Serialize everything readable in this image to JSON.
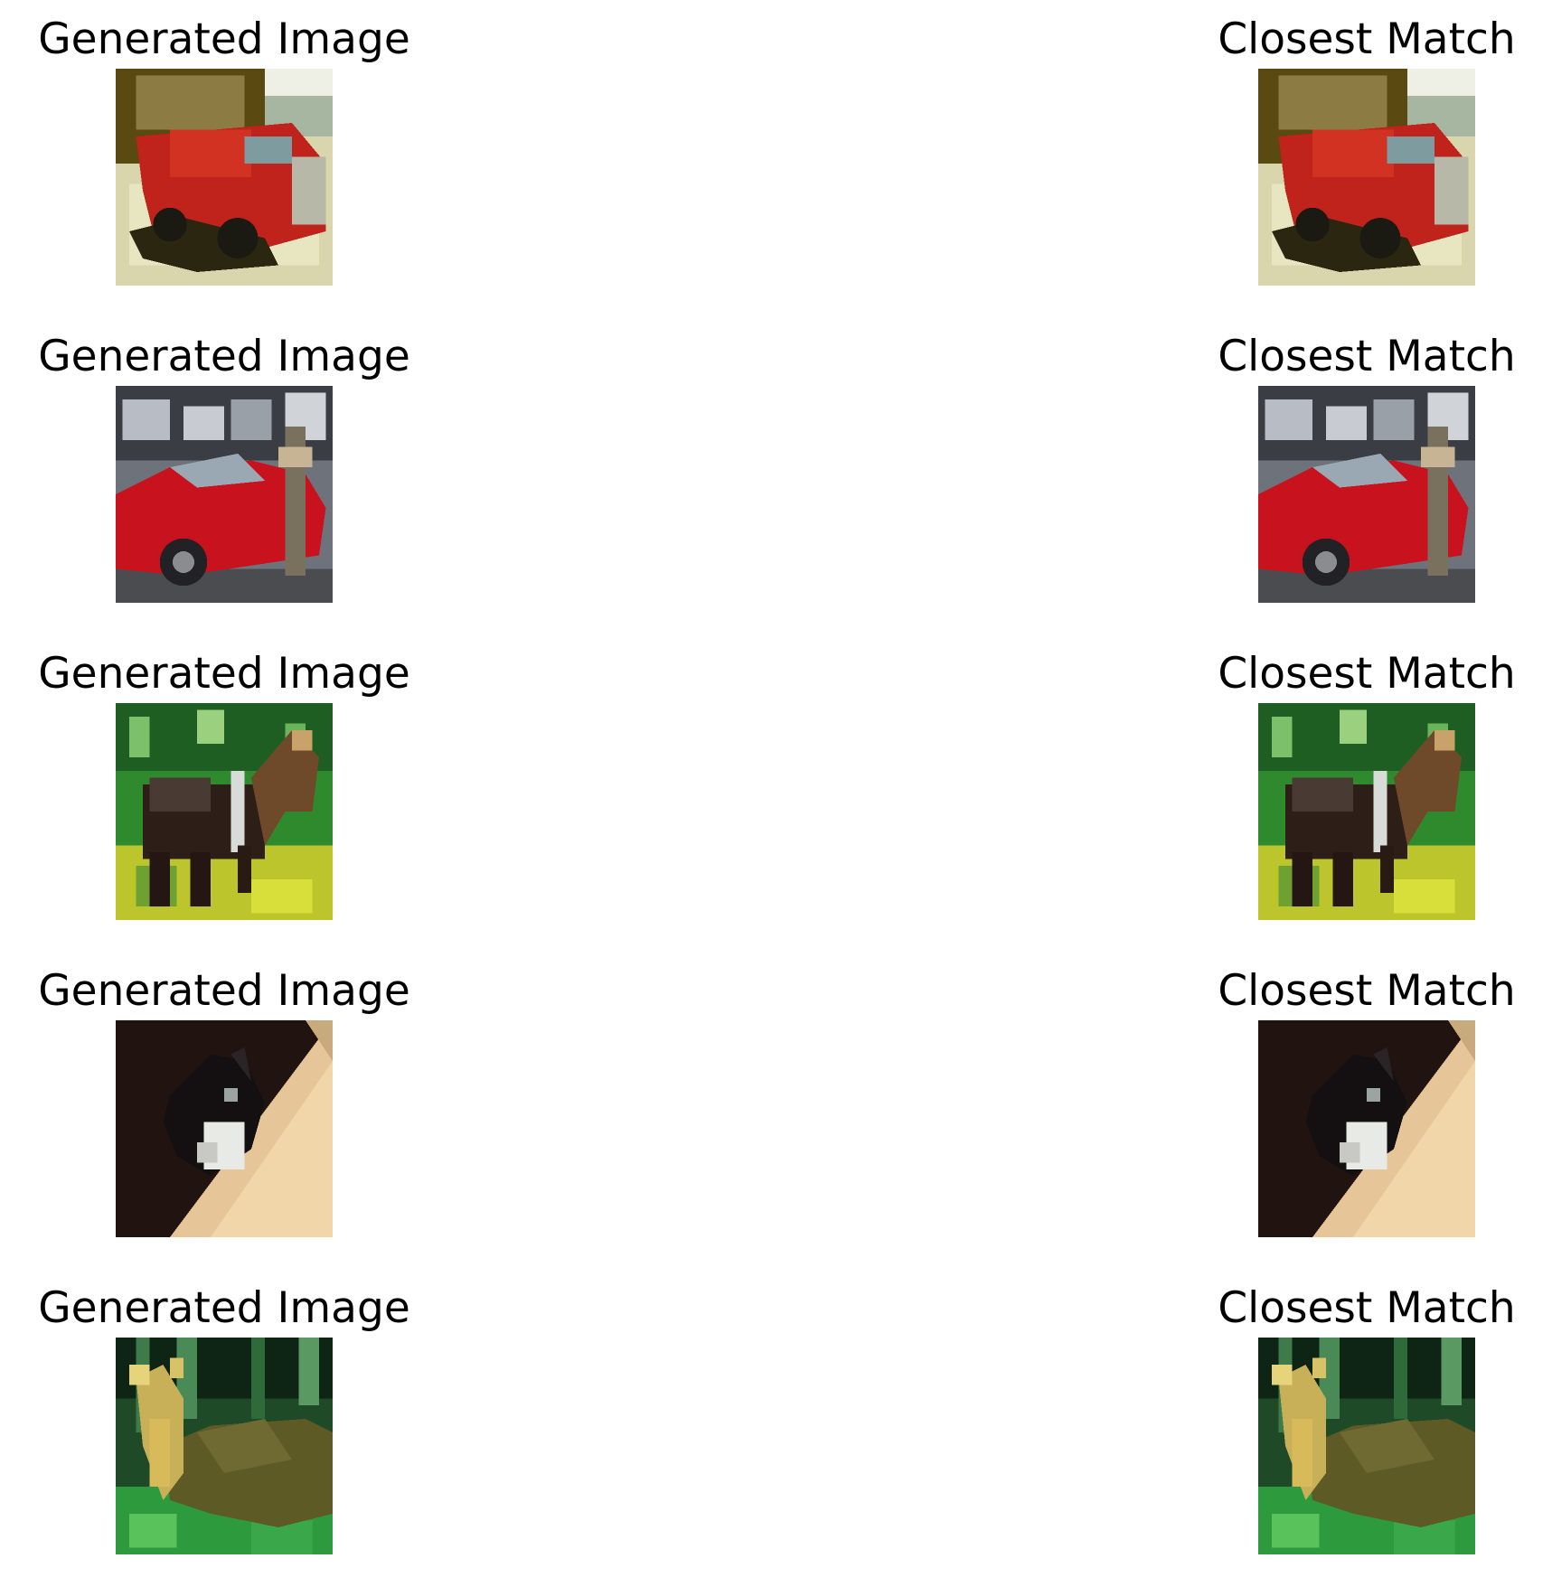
{
  "left_title": "Generated Image",
  "right_title": "Closest Match",
  "rows": [
    {
      "left": "Generated Image",
      "right": "Closest Match",
      "scene": "red-truck"
    },
    {
      "left": "Generated Image",
      "right": "Closest Match",
      "scene": "red-car"
    },
    {
      "left": "Generated Image",
      "right": "Closest Match",
      "scene": "horse-in-grass"
    },
    {
      "left": "Generated Image",
      "right": "Closest Match",
      "scene": "black-white-cat"
    },
    {
      "left": "Generated Image",
      "right": "Closest Match",
      "scene": "deer-in-forest"
    }
  ]
}
